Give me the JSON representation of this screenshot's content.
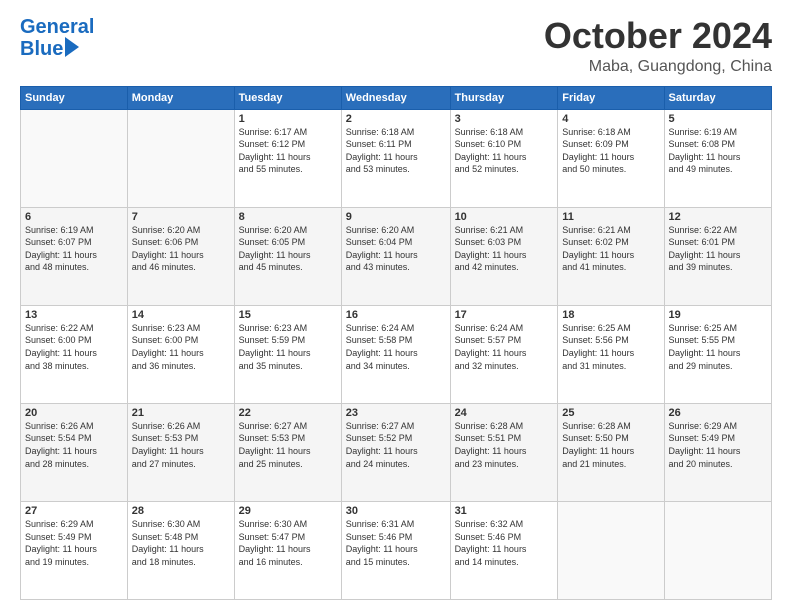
{
  "header": {
    "logo_line1": "General",
    "logo_line2": "Blue",
    "month": "October 2024",
    "location": "Maba, Guangdong, China"
  },
  "weekdays": [
    "Sunday",
    "Monday",
    "Tuesday",
    "Wednesday",
    "Thursday",
    "Friday",
    "Saturday"
  ],
  "weeks": [
    [
      {
        "day": "",
        "info": ""
      },
      {
        "day": "",
        "info": ""
      },
      {
        "day": "1",
        "info": "Sunrise: 6:17 AM\nSunset: 6:12 PM\nDaylight: 11 hours\nand 55 minutes."
      },
      {
        "day": "2",
        "info": "Sunrise: 6:18 AM\nSunset: 6:11 PM\nDaylight: 11 hours\nand 53 minutes."
      },
      {
        "day": "3",
        "info": "Sunrise: 6:18 AM\nSunset: 6:10 PM\nDaylight: 11 hours\nand 52 minutes."
      },
      {
        "day": "4",
        "info": "Sunrise: 6:18 AM\nSunset: 6:09 PM\nDaylight: 11 hours\nand 50 minutes."
      },
      {
        "day": "5",
        "info": "Sunrise: 6:19 AM\nSunset: 6:08 PM\nDaylight: 11 hours\nand 49 minutes."
      }
    ],
    [
      {
        "day": "6",
        "info": "Sunrise: 6:19 AM\nSunset: 6:07 PM\nDaylight: 11 hours\nand 48 minutes."
      },
      {
        "day": "7",
        "info": "Sunrise: 6:20 AM\nSunset: 6:06 PM\nDaylight: 11 hours\nand 46 minutes."
      },
      {
        "day": "8",
        "info": "Sunrise: 6:20 AM\nSunset: 6:05 PM\nDaylight: 11 hours\nand 45 minutes."
      },
      {
        "day": "9",
        "info": "Sunrise: 6:20 AM\nSunset: 6:04 PM\nDaylight: 11 hours\nand 43 minutes."
      },
      {
        "day": "10",
        "info": "Sunrise: 6:21 AM\nSunset: 6:03 PM\nDaylight: 11 hours\nand 42 minutes."
      },
      {
        "day": "11",
        "info": "Sunrise: 6:21 AM\nSunset: 6:02 PM\nDaylight: 11 hours\nand 41 minutes."
      },
      {
        "day": "12",
        "info": "Sunrise: 6:22 AM\nSunset: 6:01 PM\nDaylight: 11 hours\nand 39 minutes."
      }
    ],
    [
      {
        "day": "13",
        "info": "Sunrise: 6:22 AM\nSunset: 6:00 PM\nDaylight: 11 hours\nand 38 minutes."
      },
      {
        "day": "14",
        "info": "Sunrise: 6:23 AM\nSunset: 6:00 PM\nDaylight: 11 hours\nand 36 minutes."
      },
      {
        "day": "15",
        "info": "Sunrise: 6:23 AM\nSunset: 5:59 PM\nDaylight: 11 hours\nand 35 minutes."
      },
      {
        "day": "16",
        "info": "Sunrise: 6:24 AM\nSunset: 5:58 PM\nDaylight: 11 hours\nand 34 minutes."
      },
      {
        "day": "17",
        "info": "Sunrise: 6:24 AM\nSunset: 5:57 PM\nDaylight: 11 hours\nand 32 minutes."
      },
      {
        "day": "18",
        "info": "Sunrise: 6:25 AM\nSunset: 5:56 PM\nDaylight: 11 hours\nand 31 minutes."
      },
      {
        "day": "19",
        "info": "Sunrise: 6:25 AM\nSunset: 5:55 PM\nDaylight: 11 hours\nand 29 minutes."
      }
    ],
    [
      {
        "day": "20",
        "info": "Sunrise: 6:26 AM\nSunset: 5:54 PM\nDaylight: 11 hours\nand 28 minutes."
      },
      {
        "day": "21",
        "info": "Sunrise: 6:26 AM\nSunset: 5:53 PM\nDaylight: 11 hours\nand 27 minutes."
      },
      {
        "day": "22",
        "info": "Sunrise: 6:27 AM\nSunset: 5:53 PM\nDaylight: 11 hours\nand 25 minutes."
      },
      {
        "day": "23",
        "info": "Sunrise: 6:27 AM\nSunset: 5:52 PM\nDaylight: 11 hours\nand 24 minutes."
      },
      {
        "day": "24",
        "info": "Sunrise: 6:28 AM\nSunset: 5:51 PM\nDaylight: 11 hours\nand 23 minutes."
      },
      {
        "day": "25",
        "info": "Sunrise: 6:28 AM\nSunset: 5:50 PM\nDaylight: 11 hours\nand 21 minutes."
      },
      {
        "day": "26",
        "info": "Sunrise: 6:29 AM\nSunset: 5:49 PM\nDaylight: 11 hours\nand 20 minutes."
      }
    ],
    [
      {
        "day": "27",
        "info": "Sunrise: 6:29 AM\nSunset: 5:49 PM\nDaylight: 11 hours\nand 19 minutes."
      },
      {
        "day": "28",
        "info": "Sunrise: 6:30 AM\nSunset: 5:48 PM\nDaylight: 11 hours\nand 18 minutes."
      },
      {
        "day": "29",
        "info": "Sunrise: 6:30 AM\nSunset: 5:47 PM\nDaylight: 11 hours\nand 16 minutes."
      },
      {
        "day": "30",
        "info": "Sunrise: 6:31 AM\nSunset: 5:46 PM\nDaylight: 11 hours\nand 15 minutes."
      },
      {
        "day": "31",
        "info": "Sunrise: 6:32 AM\nSunset: 5:46 PM\nDaylight: 11 hours\nand 14 minutes."
      },
      {
        "day": "",
        "info": ""
      },
      {
        "day": "",
        "info": ""
      }
    ]
  ]
}
